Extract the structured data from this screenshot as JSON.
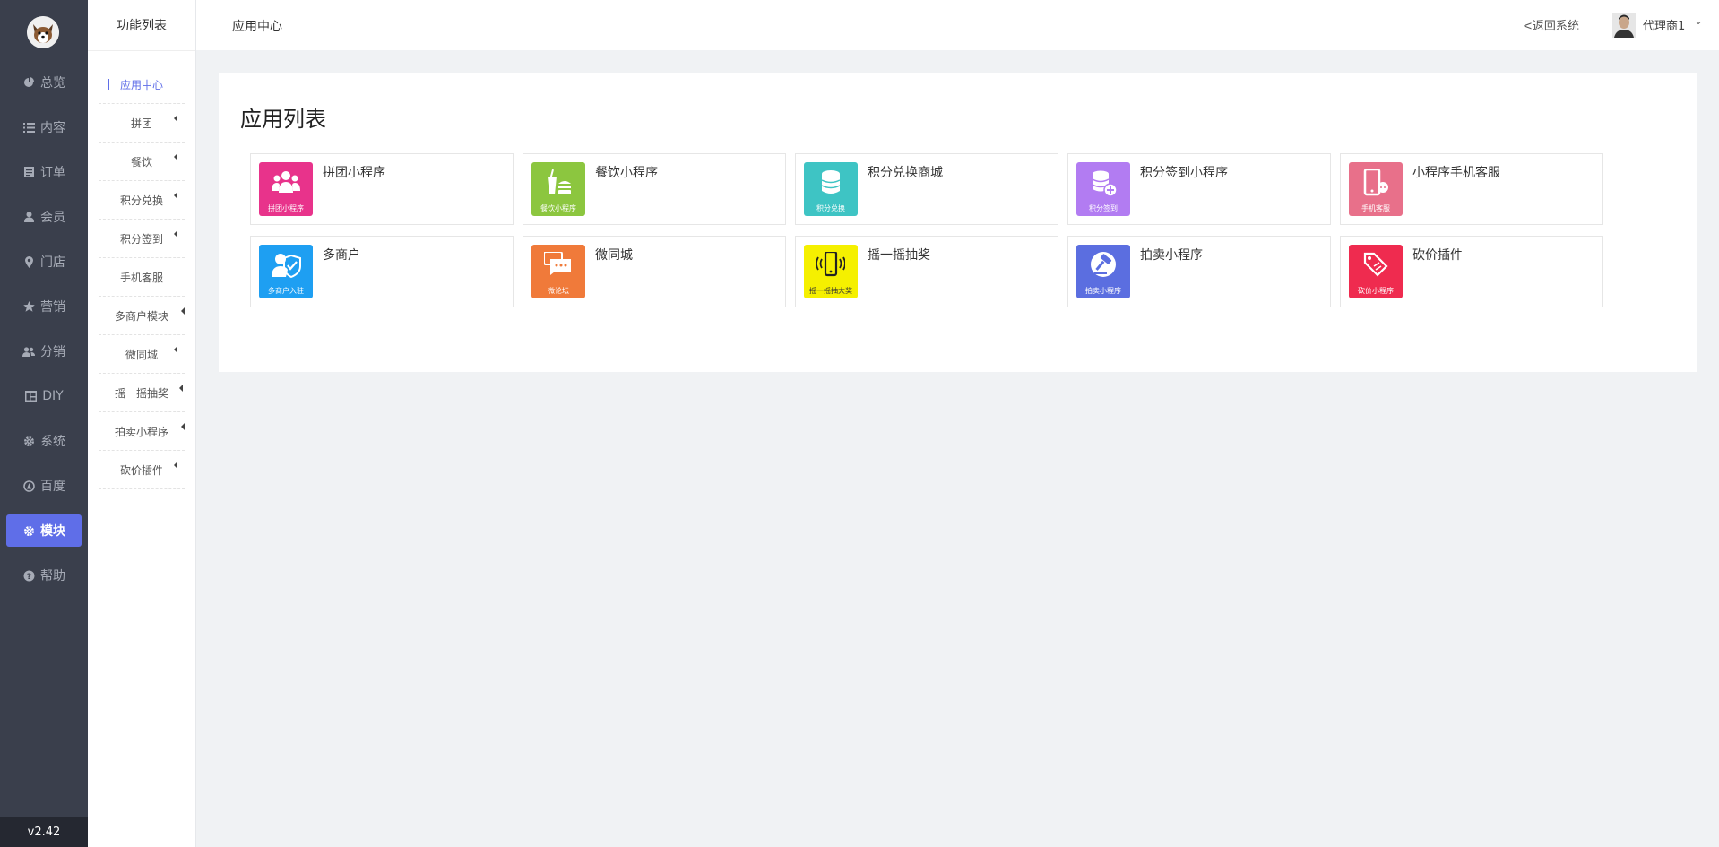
{
  "sidebar": {
    "version": "v2.42",
    "items": [
      {
        "label": "总览",
        "icon": "pie-chart-icon"
      },
      {
        "label": "内容",
        "icon": "list-icon"
      },
      {
        "label": "订单",
        "icon": "document-icon"
      },
      {
        "label": "会员",
        "icon": "user-icon"
      },
      {
        "label": "门店",
        "icon": "map-pin-icon"
      },
      {
        "label": "营销",
        "icon": "star-icon"
      },
      {
        "label": "分销",
        "icon": "users-icon"
      },
      {
        "label": "DIY",
        "icon": "layout-icon"
      },
      {
        "label": "系统",
        "icon": "gear-icon"
      },
      {
        "label": "百度",
        "icon": "baidu-icon"
      },
      {
        "label": "模块",
        "icon": "gear-icon",
        "active": true
      },
      {
        "label": "帮助",
        "icon": "help-icon"
      }
    ]
  },
  "submenu": {
    "title": "功能列表",
    "items": [
      {
        "label": "应用中心",
        "active": true,
        "arrow": false
      },
      {
        "label": "拼团",
        "arrow": true
      },
      {
        "label": "餐饮",
        "arrow": true
      },
      {
        "label": "积分兑换",
        "arrow": true
      },
      {
        "label": "积分签到",
        "arrow": true
      },
      {
        "label": "手机客服",
        "arrow": false
      },
      {
        "label": "多商户模块",
        "arrow": true
      },
      {
        "label": "微同城",
        "arrow": true
      },
      {
        "label": "摇一摇抽奖",
        "arrow": true
      },
      {
        "label": "拍卖小程序",
        "arrow": true
      },
      {
        "label": "砍价插件",
        "arrow": true
      }
    ]
  },
  "header": {
    "breadcrumb": "应用中心",
    "back_link": "<返回系统",
    "user_name": "代理商1"
  },
  "main": {
    "title": "应用列表",
    "apps": [
      {
        "name": "拼团小程序",
        "caption": "拼团小程序",
        "color": "#e8338b",
        "icon": "group-people-icon"
      },
      {
        "name": "餐饮小程序",
        "caption": "餐饮小程序",
        "color": "#8cc63f",
        "icon": "food-drink-icon"
      },
      {
        "name": "积分兑换商城",
        "caption": "积分兑换",
        "color": "#3ec4c4",
        "icon": "coin-stack-icon"
      },
      {
        "name": "积分签到小程序",
        "caption": "积分签到",
        "color": "#b27cf2",
        "icon": "coin-plus-icon"
      },
      {
        "name": "小程序手机客服",
        "caption": "手机客服",
        "color": "#e8708a",
        "icon": "phone-chat-icon"
      },
      {
        "name": "多商户",
        "caption": "多商户入驻",
        "color": "#1e9ff2",
        "icon": "merchant-check-icon"
      },
      {
        "name": "微同城",
        "caption": "微论坛",
        "color": "#f07a3a",
        "icon": "chat-bubbles-icon"
      },
      {
        "name": "摇一摇抽奖",
        "caption": "摇一摇抽大奖",
        "color": "#f5f000",
        "icon": "shake-phone-icon"
      },
      {
        "name": "拍卖小程序",
        "caption": "拍卖小程序",
        "color": "#5b6ee0",
        "icon": "auction-hammer-icon"
      },
      {
        "name": "砍价插件",
        "caption": "砍价小程序",
        "color": "#ef2b4f",
        "icon": "price-tag-icon"
      }
    ]
  }
}
